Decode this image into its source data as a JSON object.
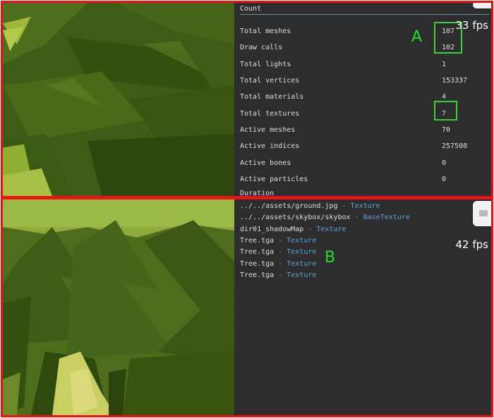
{
  "colors": {
    "frame_border": "#ee1111",
    "annotation_green": "#22e02a",
    "panel_bg": "#2c2c2c",
    "texture_type_text": "#58a6dc"
  },
  "panel_a": {
    "annotation_label": "A",
    "fps_text": "33 fps",
    "count_section_title": "Count",
    "stats": [
      {
        "label": "Total meshes",
        "value": "107"
      },
      {
        "label": "Draw calls",
        "value": "102"
      },
      {
        "label": "Total lights",
        "value": "1"
      },
      {
        "label": "Total vertices",
        "value": "153337"
      },
      {
        "label": "Total materials",
        "value": "4"
      },
      {
        "label": "Total textures",
        "value": "7"
      },
      {
        "label": "Active meshes",
        "value": "70"
      },
      {
        "label": "Active indices",
        "value": "257508"
      },
      {
        "label": "Active bones",
        "value": "0"
      },
      {
        "label": "Active particles",
        "value": "0"
      }
    ],
    "duration_section_title": "Duration"
  },
  "panel_b": {
    "annotation_label": "B",
    "fps_text": "42 fps",
    "textures": [
      {
        "name": "../../assets/ground.jpg",
        "sep": " - ",
        "type": "Texture"
      },
      {
        "name": "../../assets/skybox/skybox",
        "sep": " - ",
        "type": "BaseTexture"
      },
      {
        "name": "dir01_shadowMap",
        "sep": " - ",
        "type": "Texture"
      },
      {
        "name": "Tree.tga",
        "sep": " - ",
        "type": "Texture"
      },
      {
        "name": "Tree.tga",
        "sep": " - ",
        "type": "Texture"
      },
      {
        "name": "Tree.tga",
        "sep": " - ",
        "type": "Texture"
      },
      {
        "name": "Tree.tga",
        "sep": " - ",
        "type": "Texture"
      }
    ]
  }
}
